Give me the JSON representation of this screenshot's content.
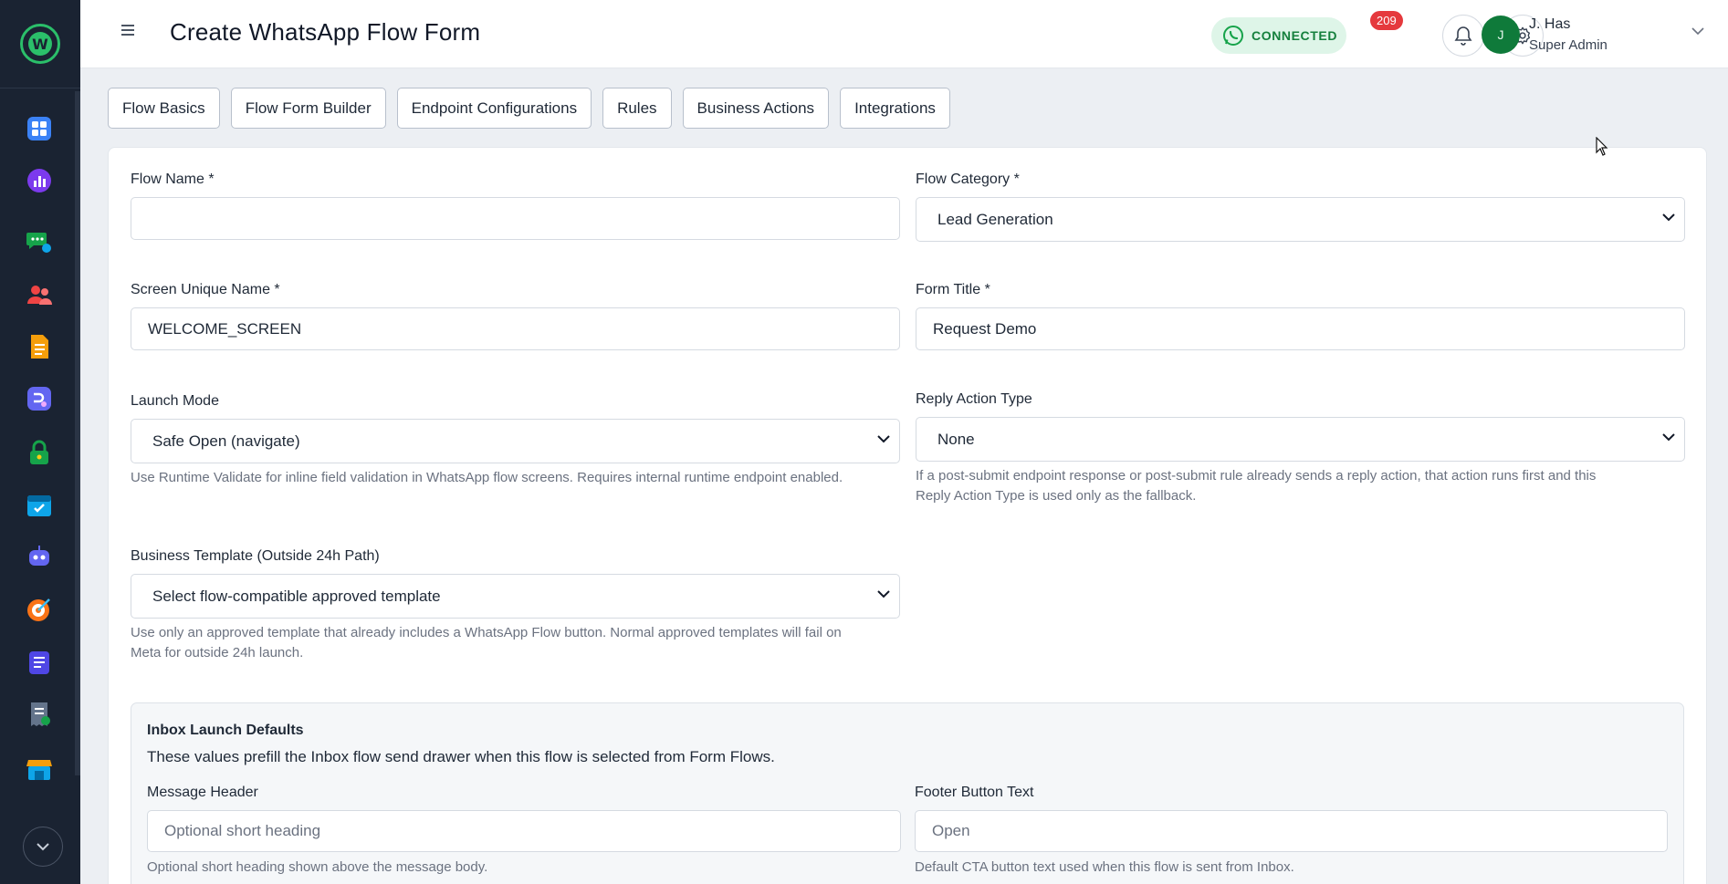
{
  "header": {
    "title": "Create WhatsApp Flow Form",
    "status_label": "CONNECTED",
    "notification_count": "209",
    "user": {
      "initial": "J",
      "name": "J. Has",
      "role": "Super Admin"
    }
  },
  "sidebar": {
    "logo_letter": "W",
    "items": [
      {
        "icon": "dashboard-icon",
        "color": "#3b82f6"
      },
      {
        "icon": "analytics-icon",
        "color": "#7c3aed"
      },
      {
        "icon": "chat-icon",
        "color": "#16a34a"
      },
      {
        "icon": "contacts-icon",
        "color": "#ef4444"
      },
      {
        "icon": "templates-icon",
        "color": "#f59e0b"
      },
      {
        "icon": "flows-icon",
        "color": "#6366f1"
      },
      {
        "icon": "security-icon",
        "color": "#16a34a"
      },
      {
        "icon": "calendar-icon",
        "color": "#0ea5e9"
      },
      {
        "icon": "bot-icon",
        "color": "#6366f1"
      },
      {
        "icon": "campaign-icon",
        "color": "#f97316"
      },
      {
        "icon": "forms-icon",
        "color": "#4f46e5"
      },
      {
        "icon": "invoice-icon",
        "color": "#64748b"
      },
      {
        "icon": "store-icon",
        "color": "#0ea5e9"
      }
    ]
  },
  "tabs": [
    "Flow Basics",
    "Flow Form Builder",
    "Endpoint Configurations",
    "Rules",
    "Business Actions",
    "Integrations"
  ],
  "form": {
    "flow_name": {
      "label": "Flow Name *",
      "value": ""
    },
    "flow_category": {
      "label": "Flow Category *",
      "value": "Lead Generation"
    },
    "screen_unique_name": {
      "label": "Screen Unique Name *",
      "value": "WELCOME_SCREEN"
    },
    "form_title": {
      "label": "Form Title *",
      "value": "Request Demo"
    },
    "launch_mode": {
      "label": "Launch Mode",
      "value": "Safe Open (navigate)",
      "help": "Use Runtime Validate for inline field validation in WhatsApp flow screens. Requires internal runtime endpoint enabled."
    },
    "reply_action_type": {
      "label": "Reply Action Type",
      "value": "None",
      "help_line1": "If a post-submit endpoint response or post-submit rule already sends a reply action, that action runs first and this",
      "help_line2": "Reply Action Type is used only as the fallback."
    },
    "business_template": {
      "label": "Business Template (Outside 24h Path)",
      "value": "Select flow-compatible approved template",
      "help_line1": "Use only an approved template that already includes a WhatsApp Flow button. Normal approved templates will fail on",
      "help_line2": "Meta for outside 24h launch."
    }
  },
  "inbox_defaults": {
    "title": "Inbox Launch Defaults",
    "description": "These values prefill the Inbox flow send drawer when this flow is selected from Form Flows.",
    "message_header": {
      "label": "Message Header",
      "placeholder": "Optional short heading",
      "help": "Optional short heading shown above the message body."
    },
    "footer_button": {
      "label": "Footer Button Text",
      "placeholder": "Open",
      "help": "Default CTA button text used when this flow is sent from Inbox."
    }
  }
}
